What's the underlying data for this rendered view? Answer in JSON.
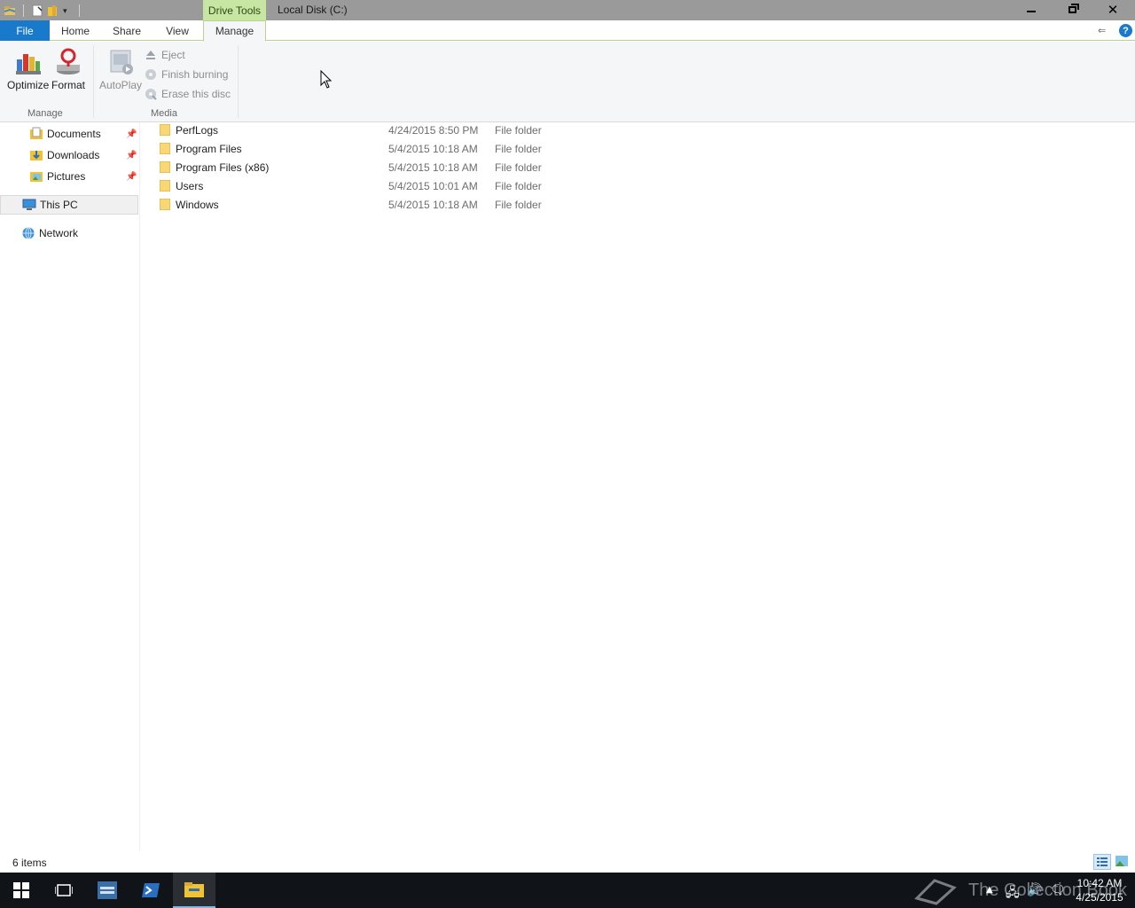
{
  "window": {
    "title": "Local Disk (C:)",
    "contextual_group": "Drive Tools"
  },
  "tabs": {
    "file": "File",
    "home": "Home",
    "share": "Share",
    "view": "View",
    "manage": "Manage",
    "help": "?"
  },
  "ribbon": {
    "optimize": "Optimize",
    "format": "Format",
    "autoplay": "AutoPlay",
    "eject": "Eject",
    "finish_burning": "Finish burning",
    "erase_disc": "Erase this disc",
    "group_manage": "Manage",
    "group_media": "Media"
  },
  "nav": {
    "documents": "Documents",
    "downloads": "Downloads",
    "pictures": "Pictures",
    "this_pc": "This PC",
    "network": "Network"
  },
  "files": [
    {
      "name": "PerfLogs",
      "date": "4/24/2015 8:50 PM",
      "type": "File folder"
    },
    {
      "name": "Program Files",
      "date": "5/4/2015 10:18 AM",
      "type": "File folder"
    },
    {
      "name": "Program Files (x86)",
      "date": "5/4/2015 10:18 AM",
      "type": "File folder"
    },
    {
      "name": "Users",
      "date": "5/4/2015 10:01 AM",
      "type": "File folder"
    },
    {
      "name": "Windows",
      "date": "5/4/2015 10:18 AM",
      "type": "File folder"
    }
  ],
  "status": {
    "item_count": "6 items"
  },
  "taskbar": {
    "time": "10:42 AM",
    "date": "4/25/2015",
    "watermark": "The Collection Book"
  },
  "colors": {
    "accent": "#1979ca",
    "contextual": "#c8e6a3",
    "folder": "#f8d775"
  }
}
